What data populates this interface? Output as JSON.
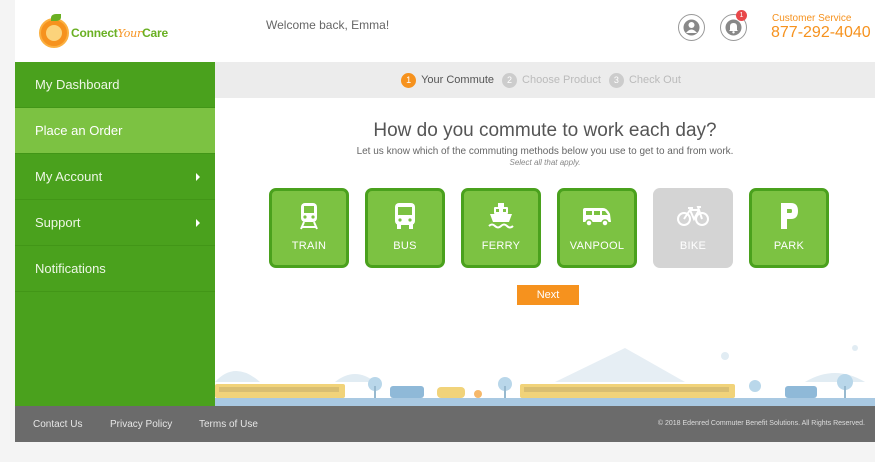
{
  "header": {
    "logo_text_1": "Connect",
    "logo_text_2": "Your",
    "logo_text_3": "Care",
    "welcome": "Welcome back, Emma!",
    "notification_count": "1",
    "cs_label": "Customer Service",
    "cs_phone": "877-292-4040"
  },
  "sidebar": {
    "items": [
      {
        "label": "My Dashboard"
      },
      {
        "label": "Place an Order"
      },
      {
        "label": "My Account"
      },
      {
        "label": "Support"
      },
      {
        "label": "Notifications"
      }
    ]
  },
  "steps": [
    {
      "num": "1",
      "label": "Your Commute"
    },
    {
      "num": "2",
      "label": "Choose Product"
    },
    {
      "num": "3",
      "label": "Check Out"
    }
  ],
  "main": {
    "question": "How do you commute to work each day?",
    "subtitle": "Let us know which of the commuting methods below you use to get to and from work.",
    "hint": "Select all that apply.",
    "modes": [
      {
        "label": "TRAIN",
        "icon": "train-icon",
        "enabled": true
      },
      {
        "label": "BUS",
        "icon": "bus-icon",
        "enabled": true
      },
      {
        "label": "FERRY",
        "icon": "ferry-icon",
        "enabled": true
      },
      {
        "label": "VANPOOL",
        "icon": "van-icon",
        "enabled": true
      },
      {
        "label": "BIKE",
        "icon": "bike-icon",
        "enabled": false
      },
      {
        "label": "PARK",
        "icon": "parking-icon",
        "enabled": true
      }
    ],
    "next_label": "Next"
  },
  "footer": {
    "contact": "Contact Us",
    "privacy": "Privacy Policy",
    "terms": "Terms of Use",
    "copyright": "© 2018 Edenred Commuter Benefit Solutions. All Rights Reserved."
  },
  "colors": {
    "green_dark": "#4aa11d",
    "green_light": "#7cc242",
    "orange": "#f6921e",
    "footer_gray": "#6b6b6b"
  }
}
